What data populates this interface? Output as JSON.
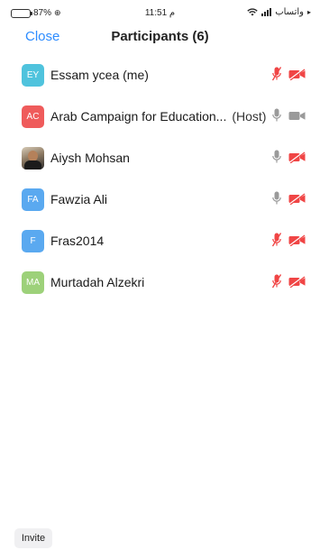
{
  "status_bar": {
    "battery": "87%",
    "time": "11:51 م",
    "carrier": "واتساب"
  },
  "nav": {
    "close_label": "Close",
    "title": "Participants (6)"
  },
  "participants": [
    {
      "initials": "EY",
      "name": "Essam ycea (me)",
      "host_tag": "",
      "avatar_color": "#4fc3dd",
      "mic": "muted",
      "video": "off"
    },
    {
      "initials": "AC",
      "name": "Arab Campaign for Education...",
      "host_tag": "(Host)",
      "avatar_color": "#ef5b5b",
      "mic": "on",
      "video": "on"
    },
    {
      "initials": "",
      "name": "Aiysh Mohsan",
      "host_tag": "",
      "avatar_color": "#6b5a48",
      "mic": "on",
      "video": "off"
    },
    {
      "initials": "FA",
      "name": "Fawzia Ali",
      "host_tag": "",
      "avatar_color": "#5aa9f0",
      "mic": "on",
      "video": "off"
    },
    {
      "initials": "F",
      "name": "Fras2014",
      "host_tag": "",
      "avatar_color": "#5aa9f0",
      "mic": "muted",
      "video": "off"
    },
    {
      "initials": "MA",
      "name": "Murtadah Alzekri",
      "host_tag": "",
      "avatar_color": "#9dd17a",
      "mic": "muted",
      "video": "off"
    }
  ],
  "footer": {
    "invite_label": "Invite"
  },
  "colors": {
    "accent": "#2d8cff",
    "muted_red": "#f04545",
    "icon_gray": "#9a9a9a"
  },
  "icons": {
    "mic_on": "microphone-icon",
    "mic_muted": "microphone-muted-icon",
    "video_on": "video-camera-icon",
    "video_off": "video-camera-off-icon"
  }
}
